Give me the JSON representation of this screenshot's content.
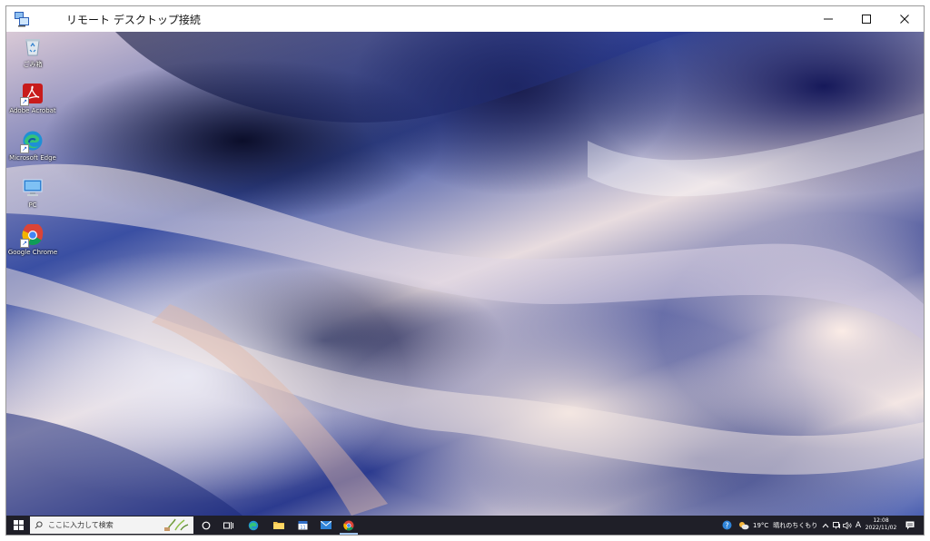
{
  "window": {
    "title": "リモート デスクトップ接続",
    "controls": {
      "minimize": "minimize",
      "maximize": "maximize",
      "close": "close"
    }
  },
  "desktop": {
    "icons": [
      {
        "label": "ごみ箱",
        "icon": "recycle-bin-icon"
      },
      {
        "label": "Adobe Acrobat",
        "icon": "acrobat-icon"
      },
      {
        "label": "Microsoft Edge",
        "icon": "edge-icon"
      },
      {
        "label": "PC",
        "icon": "pc-icon"
      },
      {
        "label": "Google Chrome",
        "icon": "chrome-icon"
      }
    ]
  },
  "taskbar": {
    "search_placeholder": "ここに入力して検索",
    "weather": {
      "temp": "19°C",
      "condition": "晴れのちくもり"
    },
    "ime": "A",
    "clock": {
      "time": "12:08",
      "date": "2022/11/02"
    },
    "colors": {
      "taskbar_bg": "#1f1f28",
      "accent": "#9fc4ef"
    }
  }
}
